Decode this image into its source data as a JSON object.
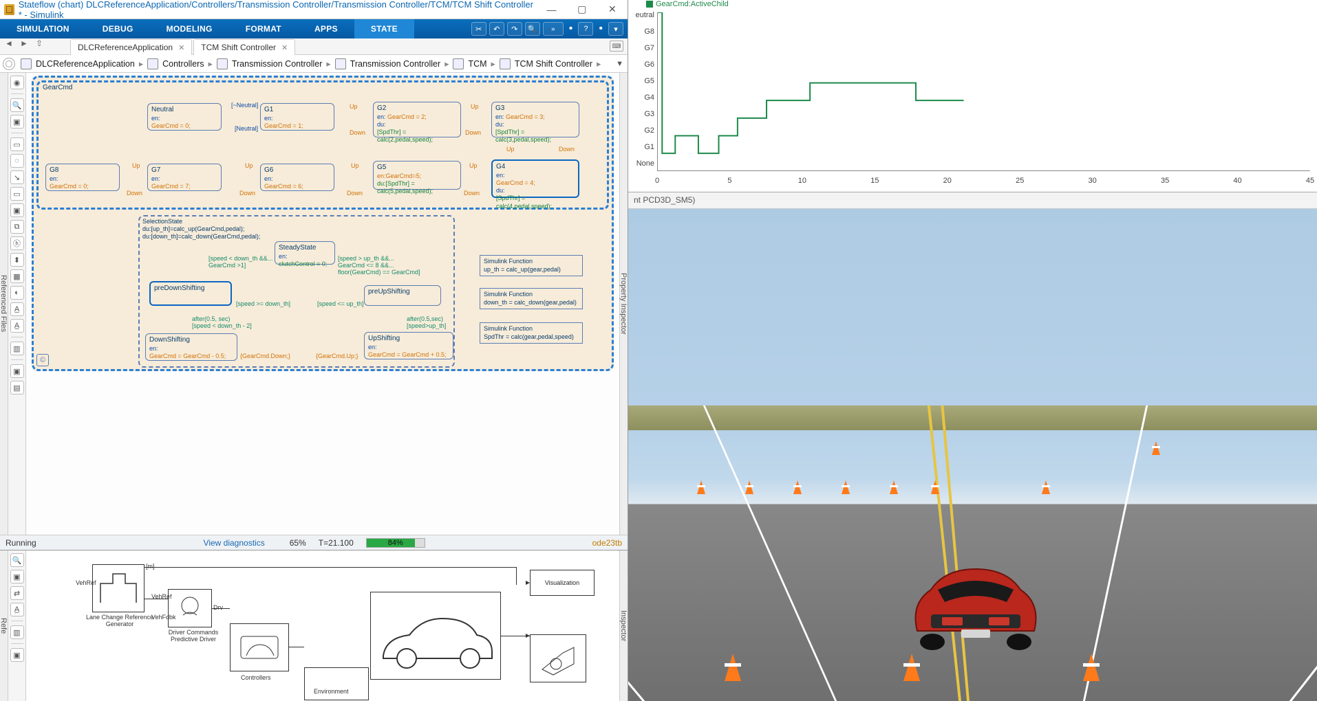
{
  "window": {
    "title": "Stateflow (chart) DLCReferenceApplication/Controllers/Transmission Controller/Transmission Controller/TCM/TCM Shift Controller * - Simulink"
  },
  "ribbon": {
    "tabs": [
      "SIMULATION",
      "DEBUG",
      "MODELING",
      "FORMAT",
      "APPS",
      "STATE"
    ],
    "activeIndex": 5,
    "quick": {
      "cut": "✂",
      "undo": "↶",
      "redo": "↷",
      "zoom": "🔍",
      "pct": "»",
      "help": "?",
      "more": "▾"
    }
  },
  "doctabs": {
    "nav": {
      "back": "◄",
      "fwd": "►",
      "up": "⇧"
    },
    "tabs": [
      {
        "label": "DLCReferenceApplication"
      },
      {
        "label": "TCM Shift Controller"
      }
    ]
  },
  "breadcrumb": {
    "items": [
      "DLCReferenceApplication",
      "Controllers",
      "Transmission Controller",
      "Transmission Controller",
      "TCM",
      "TCM Shift Controller"
    ]
  },
  "sidestrips": {
    "left": "Referenced Files",
    "rightTop": "Property Inspector",
    "leftLower": "Refe",
    "rightLower": "Inspector"
  },
  "chart": {
    "super1": {
      "title": "GearCmd"
    },
    "states": {
      "neutral": {
        "name": "Neutral",
        "l1": "en:",
        "l2": "GearCmd = 0;"
      },
      "g1": {
        "name": "G1",
        "l1": "en:",
        "l2": "GearCmd = 1;"
      },
      "g2": {
        "name": "G2",
        "l1": "en:",
        "l2": "GearCmd = 2;",
        "l3": "du:",
        "l4": "[SpdThr] = calc(2,pedal,speed);"
      },
      "g3": {
        "name": "G3",
        "l1": "en:",
        "l2": "GearCmd = 3;",
        "l3": "du:",
        "l4": "[SpdThr] = calc(3,pedal,speed);"
      },
      "g4": {
        "name": "G4",
        "l1": "en:",
        "l2": "GearCmd = 4;",
        "l3": "du:",
        "l4": "[SpdThr] = calc(4,pedal,speed);"
      },
      "g5": {
        "name": "G5",
        "l1": "en:GearCmd=5;",
        "l2": "du:[SpdThr] = calc(5,pedal,speed);"
      },
      "g6": {
        "name": "G6",
        "l1": "en:",
        "l2": "GearCmd = 6;"
      },
      "g7": {
        "name": "G7",
        "l1": "en:",
        "l2": "GearCmd = 7;"
      },
      "g8": {
        "name": "G8",
        "l1": "en:",
        "l2": "GearCmd = 0;"
      }
    },
    "trans": {
      "up": "Up",
      "down": "Down",
      "neutral": "[Neutral]",
      "notneutral": "[~Neutral]"
    },
    "super2": {
      "title": "SelectionState",
      "du1": "du:[up_th]=calc_up(GearCmd,pedal);",
      "du2": "du:[down_th]=calc_down(GearCmd,pedal);"
    },
    "sel": {
      "steady": {
        "name": "SteadyState",
        "l1": "en:",
        "l2": "clutchControl = 0;"
      },
      "predown": {
        "name": "preDownShifting"
      },
      "preup": {
        "name": "preUpShifting"
      },
      "down": {
        "name": "DownShifting",
        "l1": "en:",
        "l2": "GearCmd = GearCmd - 0.5;"
      },
      "up": {
        "name": "UpShifting",
        "l1": "en:",
        "l2": "GearCmd = GearCmd + 0.5;"
      },
      "guardDown": "[speed < down_th &&...\nGearCmd >1]",
      "guardUp": "[speed > up_th &&...\nGearCmd <= 8 &&...\nfloor(GearCmd) == GearCmd]",
      "retDown": "[speed >= down_th]",
      "retUp": "[speed <= up_th]",
      "afterDown": "after(0.5, sec)\n[speed < down_th - 2]",
      "afterUp": "after(0.5,sec)\n[speed>up_th]",
      "evDown": "{GearCmd.Down;}",
      "evUp": "{GearCmd.Up;}"
    },
    "funcs": {
      "f1": {
        "t": "Simulink Function",
        "b": "up_th = calc_up(gear,pedal)"
      },
      "f2": {
        "t": "Simulink Function",
        "b": "down_th = calc_down(gear,pedal)"
      },
      "f3": {
        "t": "Simulink Function",
        "b": "SpdThr = calc(gear,pedal,speed)"
      }
    },
    "copyright": "©"
  },
  "status": {
    "state": "Running",
    "viewdiag": "View diagnostics",
    "pct": "65%",
    "time": "T=21.100",
    "progress": 84,
    "progress_label": "84%",
    "solver": "ode23tb"
  },
  "model": {
    "blocks": {
      "ref": {
        "label": "Lane Change Reference\nGenerator",
        "sig1": "Lane",
        "sig2": "VehRef",
        "sig3": "[m]"
      },
      "drv": {
        "label": "Driver Commands\nPredictive Driver",
        "in1": "VehFdbk",
        "in2": "VehRef",
        "out": "Drv"
      },
      "ctl": {
        "label": "Controllers"
      },
      "env": {
        "label": "Environment"
      },
      "vis": {
        "label": "Visualization"
      }
    }
  },
  "plot": {
    "legend": "GearCmd:ActiveChild",
    "yticks": [
      "eutral",
      "G8",
      "G7",
      "G6",
      "G5",
      "G4",
      "G3",
      "G2",
      "G1",
      "None"
    ],
    "xticks": [
      "0",
      "5",
      "10",
      "15",
      "20",
      "25",
      "30",
      "35",
      "40",
      "45"
    ]
  },
  "chart_data": {
    "type": "line",
    "title": "GearCmd:ActiveChild",
    "xlabel": "",
    "ylabel": "",
    "xlim": [
      0,
      45
    ],
    "y_categories": [
      "None",
      "G1",
      "G2",
      "G3",
      "G4",
      "G5",
      "G6",
      "G7",
      "G8",
      "Neutral"
    ],
    "series": [
      {
        "name": "GearCmd:ActiveChild",
        "x": [
          0,
          0.3,
          0.3,
          1.2,
          1.2,
          2.8,
          2.8,
          4.2,
          4.2,
          5.5,
          5.5,
          7.5,
          7.5,
          10.5,
          10.5,
          17.8,
          17.8,
          21.1
        ],
        "y": [
          "Neutral",
          "Neutral",
          "G1",
          "G1",
          "G2",
          "G2",
          "G1",
          "G1",
          "G2",
          "G2",
          "G3",
          "G3",
          "G4",
          "G4",
          "G5",
          "G5",
          "G4",
          "G4"
        ]
      }
    ]
  },
  "sim3d": {
    "caption": "nt PCD3D_SM5)"
  }
}
